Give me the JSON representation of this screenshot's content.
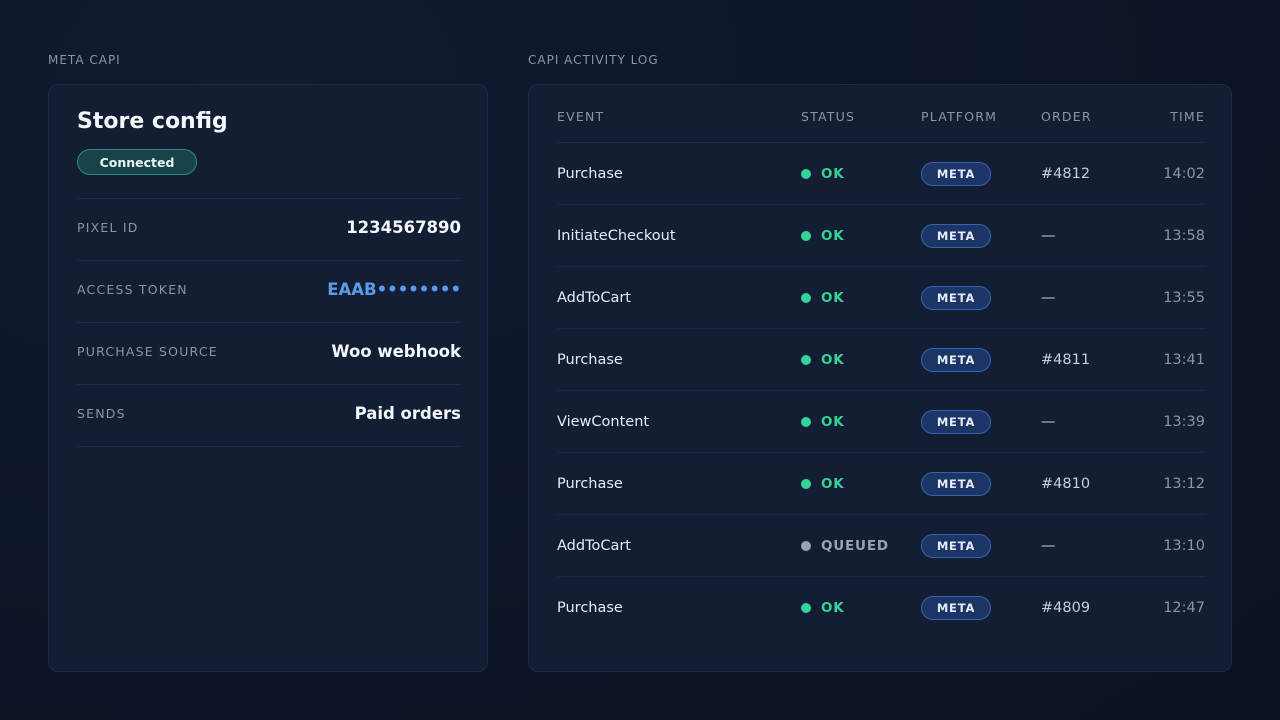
{
  "config_panel": {
    "section_label": "META CAPI",
    "title": "Store config",
    "status_badge": "Connected",
    "rows": [
      {
        "key": "PIXEL ID",
        "value": "1234567890"
      },
      {
        "key": "ACCESS TOKEN",
        "value": "EAAB••••••••"
      },
      {
        "key": "PURCHASE SOURCE",
        "value": "Woo webhook"
      },
      {
        "key": "SENDS",
        "value": "Paid orders"
      }
    ]
  },
  "activity_log": {
    "section_label": "CAPI ACTIVITY LOG",
    "columns": {
      "event": "EVENT",
      "status": "STATUS",
      "platform": "PLATFORM",
      "order": "ORDER",
      "time": "TIME"
    },
    "rows": [
      {
        "event": "Purchase",
        "status": "OK",
        "platform": "META",
        "order": "#4812",
        "time": "14:02"
      },
      {
        "event": "InitiateCheckout",
        "status": "OK",
        "platform": "META",
        "order": "—",
        "time": "13:58"
      },
      {
        "event": "AddToCart",
        "status": "OK",
        "platform": "META",
        "order": "—",
        "time": "13:55"
      },
      {
        "event": "Purchase",
        "status": "OK",
        "platform": "META",
        "order": "#4811",
        "time": "13:41"
      },
      {
        "event": "ViewContent",
        "status": "OK",
        "platform": "META",
        "order": "—",
        "time": "13:39"
      },
      {
        "event": "Purchase",
        "status": "OK",
        "platform": "META",
        "order": "#4810",
        "time": "13:12"
      },
      {
        "event": "AddToCart",
        "status": "QUEUED",
        "platform": "META",
        "order": "—",
        "time": "13:10"
      },
      {
        "event": "Purchase",
        "status": "OK",
        "platform": "META",
        "order": "#4809",
        "time": "12:47"
      }
    ]
  },
  "colors": {
    "status_ok": "#34d399",
    "status_queued": "#9aa3ae",
    "accent_token": "#5b9be8",
    "badge_connected_bg": "#17434b",
    "platform_pill_bg": "#1b3566"
  }
}
